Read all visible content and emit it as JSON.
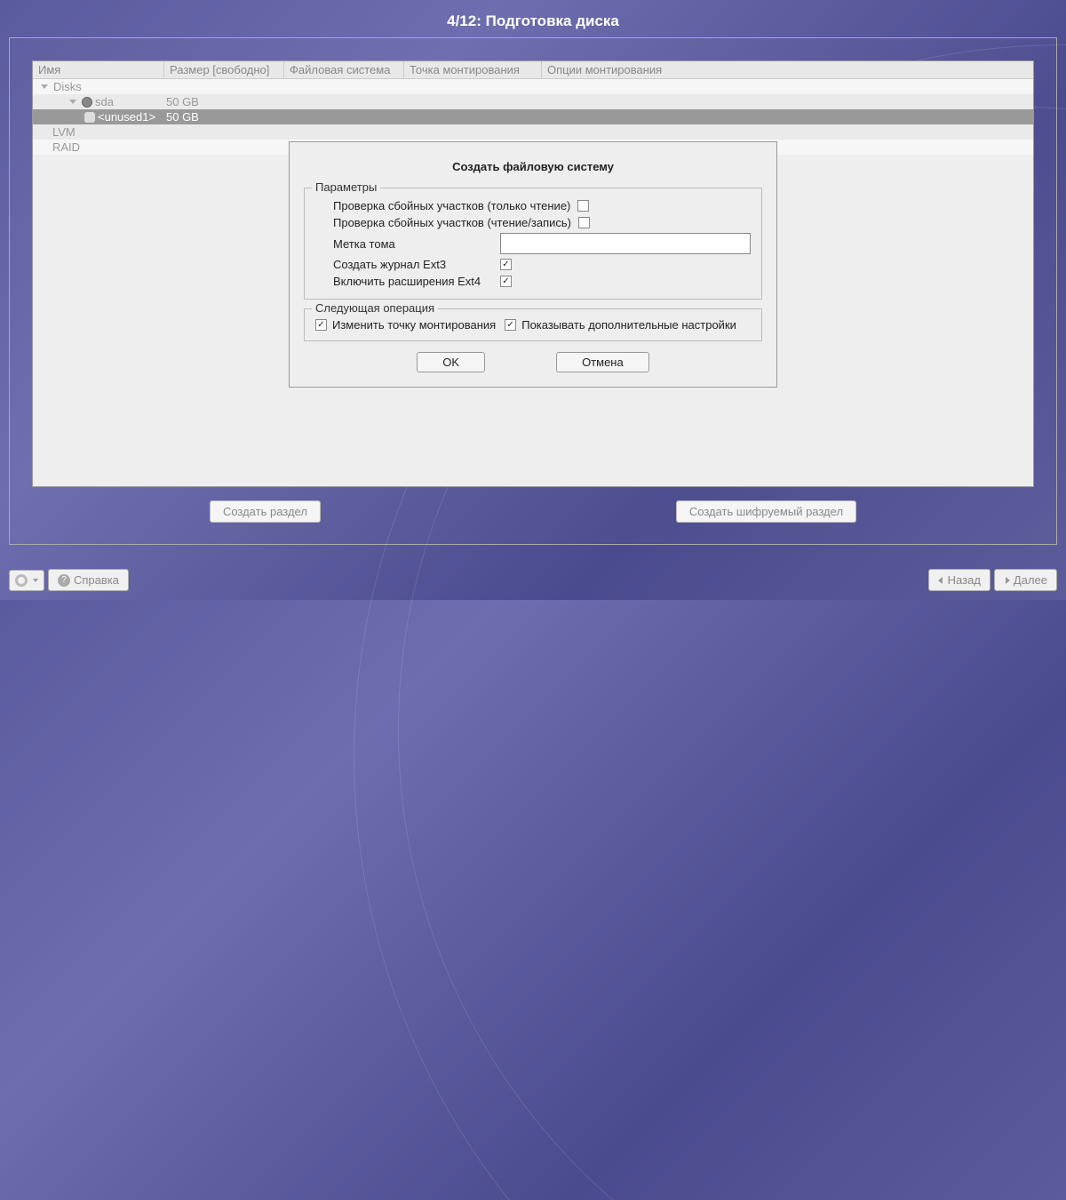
{
  "header": {
    "title": "4/12: Подготовка диска"
  },
  "tree": {
    "columns": {
      "name": "Имя",
      "size": "Размер [свободно]",
      "fs": "Файловая система",
      "mount": "Точка монтирования",
      "opts": "Опции монтирования"
    },
    "rows": {
      "disks": "Disks",
      "sda": {
        "name": "sda",
        "size": "50 GB"
      },
      "unused": {
        "name": "<unused1>",
        "size": "50 GB"
      },
      "lvm": "LVM",
      "raid": "RAID"
    }
  },
  "actions": {
    "create": "Создать раздел",
    "create_encrypted": "Создать шифруемый раздел"
  },
  "dialog": {
    "title": "Создать файловую систему",
    "params_legend": "Параметры",
    "check_ro": "Проверка сбойных участков (только чтение)",
    "check_rw": "Проверка сбойных участков (чтение/запись)",
    "volume_label": "Метка тома",
    "ext3_journal": "Создать журнал Ext3",
    "ext4_ext": "Включить расширения Ext4",
    "next_op_legend": "Следующая операция",
    "change_mount": "Изменить точку монтирования",
    "show_advanced": "Показывать дополнительные настройки",
    "ok": "OK",
    "cancel": "Отмена"
  },
  "footer": {
    "help": "Справка",
    "back": "Назад",
    "next": "Далее"
  }
}
